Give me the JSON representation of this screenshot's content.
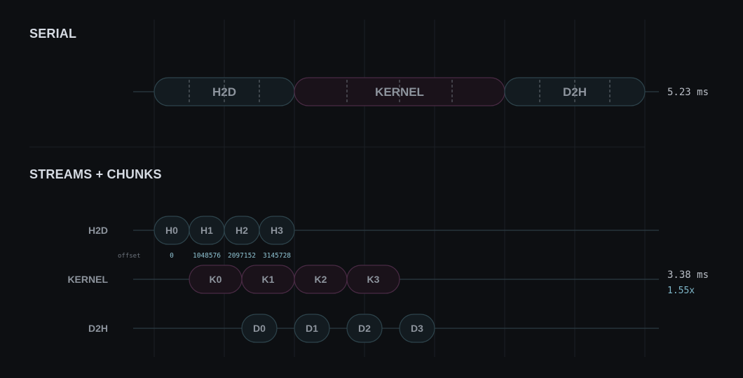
{
  "colors": {
    "background": "#0d0f12",
    "grid": "#1b1f25",
    "lane_line": "#2c3c44",
    "transfer_fill": "#131b20",
    "transfer_stroke": "#2e444c",
    "kernel_fill": "#1a121a",
    "kernel_stroke": "#4a2b45",
    "chunk_divider": "#6a7078"
  },
  "serial": {
    "title": "SERIAL",
    "total_time": "5.23 ms",
    "phases": [
      {
        "label": "H2D",
        "kind": "transfer",
        "start": 0,
        "end": 2
      },
      {
        "label": "KERNEL",
        "kind": "kernel",
        "start": 2,
        "end": 5
      },
      {
        "label": "D2H",
        "kind": "transfer",
        "start": 5,
        "end": 7
      }
    ]
  },
  "streams": {
    "title": "STREAMS + CHUNKS",
    "total_time": "3.38 ms",
    "speedup": "1.55x",
    "offset_label": "offset",
    "lanes": [
      {
        "label": "H2D",
        "kind": "transfer",
        "chunks": [
          {
            "label": "H0",
            "start": 0,
            "end": 0.5
          },
          {
            "label": "H1",
            "start": 0.5,
            "end": 1.0
          },
          {
            "label": "H2",
            "start": 1.0,
            "end": 1.5
          },
          {
            "label": "H3",
            "start": 1.5,
            "end": 2.0
          }
        ],
        "offsets": [
          "0",
          "1048576",
          "2097152",
          "3145728"
        ]
      },
      {
        "label": "KERNEL",
        "kind": "kernel",
        "chunks": [
          {
            "label": "K0",
            "start": 0.5,
            "end": 1.25
          },
          {
            "label": "K1",
            "start": 1.25,
            "end": 2.0
          },
          {
            "label": "K2",
            "start": 2.0,
            "end": 2.75
          },
          {
            "label": "K3",
            "start": 2.75,
            "end": 3.5
          }
        ]
      },
      {
        "label": "D2H",
        "kind": "transfer",
        "chunks": [
          {
            "label": "D0",
            "start": 1.25,
            "end": 1.75
          },
          {
            "label": "D1",
            "start": 2.0,
            "end": 2.5
          },
          {
            "label": "D2",
            "start": 2.75,
            "end": 3.25
          },
          {
            "label": "D3",
            "start": 3.5,
            "end": 4.0
          }
        ]
      }
    ]
  }
}
